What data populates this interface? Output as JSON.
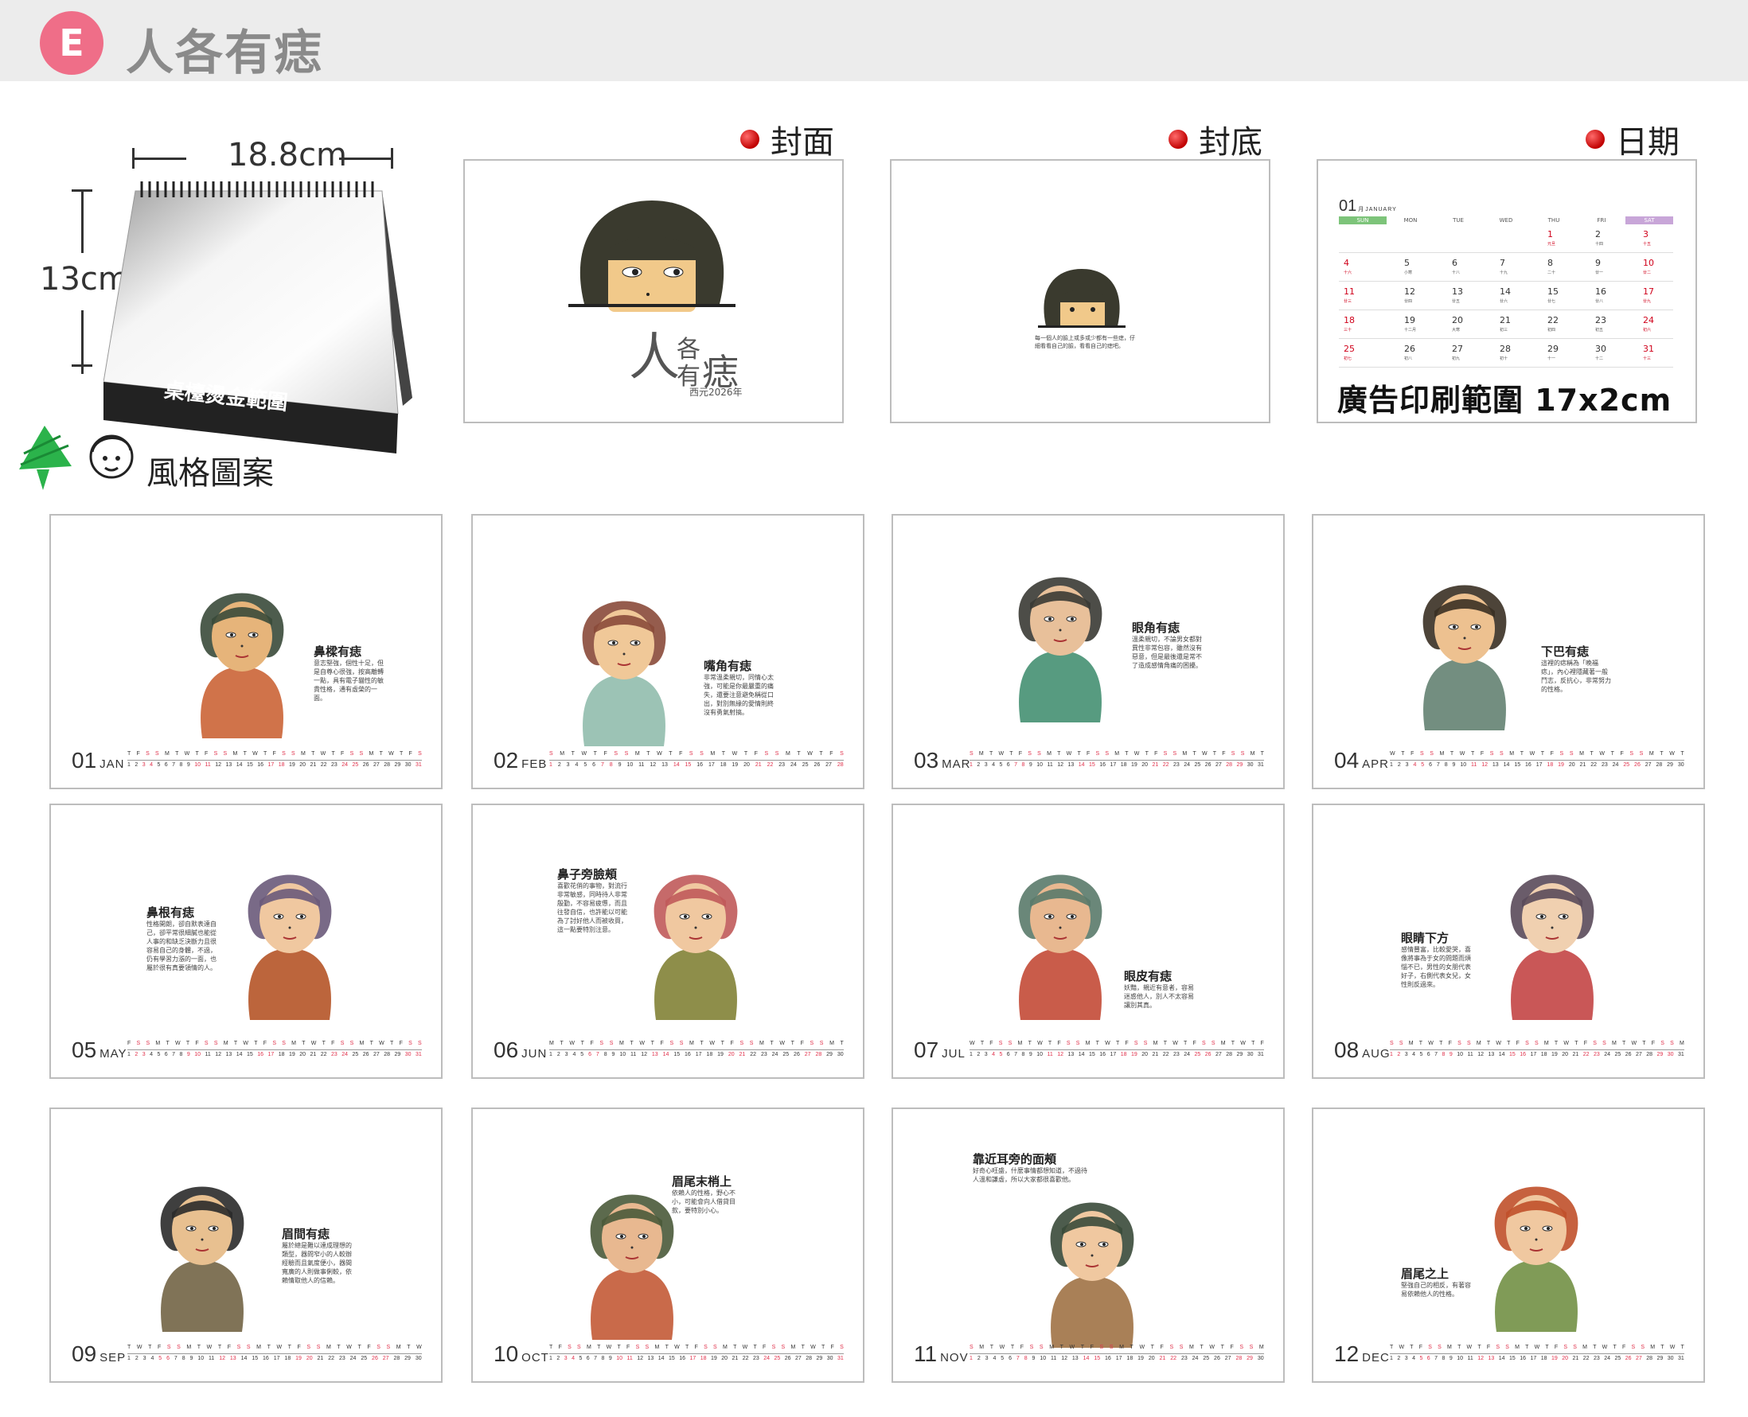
{
  "header": {
    "badge": "E",
    "title": "人各有痣"
  },
  "product": {
    "width_label": "18.8cm",
    "height_label": "13cm",
    "hotstamp_label": "桌檯燙金範圍"
  },
  "style_label": "風格圖案",
  "sections": {
    "cover": "封面",
    "back": "封底",
    "date": "日期"
  },
  "cover": {
    "title_1": "人",
    "title_2": "各",
    "title_3": "有",
    "title_4": "痣",
    "year": "西元2026年"
  },
  "back": {
    "text": "每一個人的臉上或多或少都有一些痣，仔細看看自己的臉，看看自己的痣吧。"
  },
  "date_card": {
    "month_num": "01",
    "month_small": "月",
    "month_name": "JANUARY",
    "weekdays": [
      "SUN",
      "MON",
      "TUE",
      "WED",
      "THU",
      "FRI",
      "SAT"
    ],
    "weeks": [
      [
        {
          "d": "",
          "l": ""
        },
        {
          "d": "",
          "l": ""
        },
        {
          "d": "",
          "l": ""
        },
        {
          "d": "",
          "l": ""
        },
        {
          "d": "1",
          "l": "元旦"
        },
        {
          "d": "2",
          "l": "十四"
        },
        {
          "d": "3",
          "l": "十五"
        }
      ],
      [
        {
          "d": "4",
          "l": "十六"
        },
        {
          "d": "5",
          "l": "小寒"
        },
        {
          "d": "6",
          "l": "十八"
        },
        {
          "d": "7",
          "l": "十九"
        },
        {
          "d": "8",
          "l": "二十"
        },
        {
          "d": "9",
          "l": "廿一"
        },
        {
          "d": "10",
          "l": "廿二"
        }
      ],
      [
        {
          "d": "11",
          "l": "廿三"
        },
        {
          "d": "12",
          "l": "廿四"
        },
        {
          "d": "13",
          "l": "廿五"
        },
        {
          "d": "14",
          "l": "廿六"
        },
        {
          "d": "15",
          "l": "廿七"
        },
        {
          "d": "16",
          "l": "廿八"
        },
        {
          "d": "17",
          "l": "廿九"
        }
      ],
      [
        {
          "d": "18",
          "l": "三十"
        },
        {
          "d": "19",
          "l": "十二月"
        },
        {
          "d": "20",
          "l": "大寒"
        },
        {
          "d": "21",
          "l": "初三"
        },
        {
          "d": "22",
          "l": "初四"
        },
        {
          "d": "23",
          "l": "初五"
        },
        {
          "d": "24",
          "l": "初六"
        }
      ],
      [
        {
          "d": "25",
          "l": "初七"
        },
        {
          "d": "26",
          "l": "初八"
        },
        {
          "d": "27",
          "l": "初九"
        },
        {
          "d": "28",
          "l": "初十"
        },
        {
          "d": "29",
          "l": "十一"
        },
        {
          "d": "30",
          "l": "十二"
        },
        {
          "d": "31",
          "l": "十三"
        }
      ]
    ],
    "ad_label": "廣告印刷範圍 17x2cm"
  },
  "months": [
    {
      "num": "01",
      "abbr": "JAN",
      "title": "鼻樑有痣",
      "desc": "意志堅強，個性十足，但是自尊心很強，按高離轉一點，具有電子貓性的敏貴性格，通有虛榮的一面。",
      "days": 31,
      "start": 4
    },
    {
      "num": "02",
      "abbr": "FEB",
      "title": "嘴角有痣",
      "desc": "非常溫柔親切，同情心太強，可能是你最嚴重的痛失，還要注意避免稱從口出，對別無緣的愛情則終沒有勇氣射搞。",
      "days": 28,
      "start": 0
    },
    {
      "num": "03",
      "abbr": "MAR",
      "title": "眼角有痣",
      "desc": "溫柔親切，不論男女都對異性非常包容，雖然沒有惡意，但是最後還是常不了造成感情角痛的困擾。",
      "days": 31,
      "start": 0
    },
    {
      "num": "04",
      "abbr": "APR",
      "title": "下巴有痣",
      "desc": "這裡的痣稱為「晚福痣」，內心裡隱藏著一般鬥志，反抗心，非常努力的性格。",
      "days": 30,
      "start": 3
    },
    {
      "num": "05",
      "abbr": "MAY",
      "title": "鼻根有痣",
      "desc": "性格開朗，卻自默表達自己，卻平常很細膩也能從人事的和缺乏決斷力且很容易自己的身體，不過，仍有學習力漲的一面，也屬於很有真要領情的人。",
      "days": 31,
      "start": 5
    },
    {
      "num": "06",
      "abbr": "JUN",
      "title": "鼻子旁臉頰",
      "desc": "喜歡花俏的事物，對流行非常敏感，同時待人非常殷勤，不容易疲憊，而且往發自信，也許能以可能為了討好他人而被收買，這一點要特別注意。",
      "days": 30,
      "start": 1
    },
    {
      "num": "07",
      "abbr": "JUL",
      "title": "眼皮有痣",
      "desc": "妖豔，親近有意者，容易迷惑他人，別人不太容易讓別其真。",
      "days": 31,
      "start": 3
    },
    {
      "num": "08",
      "abbr": "AUG",
      "title": "眼睛下方",
      "desc": "感情豐富，比較愛哭，喜像將事為于女的問題而煩惱不已，男性的女朋代表好子，右側代表女兒，女性則反過來。",
      "days": 31,
      "start": 6
    },
    {
      "num": "09",
      "abbr": "SEP",
      "title": "眉間有痣",
      "desc": "屬於總是難以達成理想的類型，器問窄小的人較辦經驗而且氣度便小，器間寬廣的人則做事俐較，依賴情取他人的信賴。",
      "days": 30,
      "start": 2
    },
    {
      "num": "10",
      "abbr": "OCT",
      "title": "眉尾末梢上",
      "desc": "依賴人的性格，野心不小，可能會向人借貸目款，要特別小心。",
      "days": 31,
      "start": 4
    },
    {
      "num": "11",
      "abbr": "NOV",
      "title": "靠近耳旁的面頰",
      "desc": "好奇心旺盛，什麼事情都想知道，不過待人溫和謙虛，所以大家都很喜歡他。",
      "days": 30,
      "start": 0
    },
    {
      "num": "12",
      "abbr": "DEC",
      "title": "眉尾之上",
      "desc": "堅強自己的相反，有著容易依賴他人的性格。",
      "days": 31,
      "start": 2
    }
  ],
  "weekday_letters": [
    "S",
    "M",
    "T",
    "W",
    "T",
    "F",
    "S"
  ]
}
